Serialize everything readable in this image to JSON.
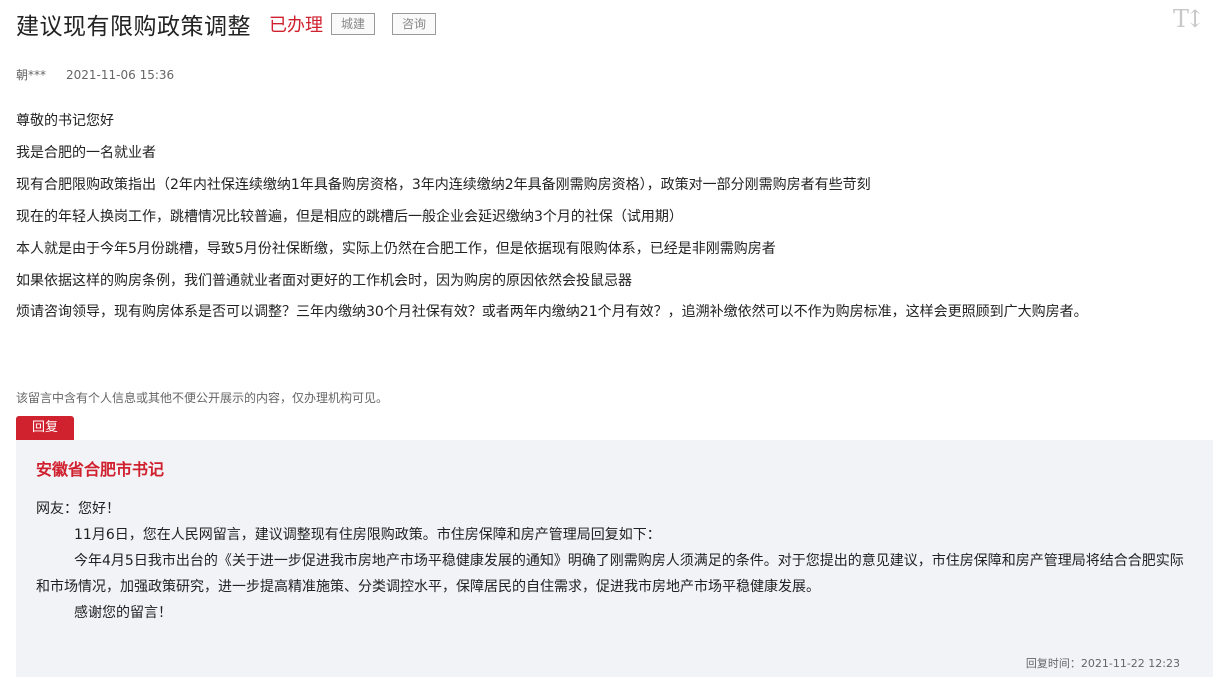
{
  "header": {
    "title": "建议现有限购政策调整",
    "status": "已办理",
    "tags": [
      "城建",
      "咨询"
    ],
    "font_tool_label": "T↕"
  },
  "meta": {
    "author": "朝***",
    "time": "2021-11-06 15:36"
  },
  "content": {
    "paragraphs": [
      "尊敬的书记您好",
      "我是合肥的一名就业者",
      "现有合肥限购政策指出（2年内社保连续缴纳1年具备购房资格，3年内连续缴纳2年具备刚需购房资格），政策对一部分刚需购房者有些苛刻",
      "现在的年轻人换岗工作，跳槽情况比较普遍，但是相应的跳槽后一般企业会延迟缴纳3个月的社保（试用期）",
      "本人就是由于今年5月份跳槽，导致5月份社保断缴，实际上仍然在合肥工作，但是依据现有限购体系，已经是非刚需购房者",
      "如果依据这样的购房条例，我们普通就业者面对更好的工作机会时，因为购房的原因依然会投鼠忌器",
      "烦请咨询领导，现有购房体系是否可以调整？三年内缴纳30个月社保有效？或者两年内缴纳21个月有效？，追溯补缴依然可以不作为购房标准，这样会更照顾到广大购房者。"
    ]
  },
  "notice": "该留言中含有个人信息或其他不便公开展示的内容，仅办理机构可见。",
  "reply": {
    "tab_label": "回复",
    "replier": "安徽省合肥市书记",
    "greeting": "网友：您好！",
    "paragraphs": [
      "11月6日，您在人民网留言，建议调整现有住房限购政策。市住房保障和房产管理局回复如下：",
      "今年4月5日我市出台的《关于进一步促进我市房地产市场平稳健康发展的通知》明确了刚需购房人须满足的条件。对于您提出的意见建议，市住房保障和房产管理局将结合合肥实际和市场情况，加强政策研究，进一步提高精准施策、分类调控水平，保障居民的自住需求，促进我市房地产市场平稳健康发展。",
      "感谢您的留言！"
    ],
    "time": "回复时间：2021-11-22 12:23"
  }
}
